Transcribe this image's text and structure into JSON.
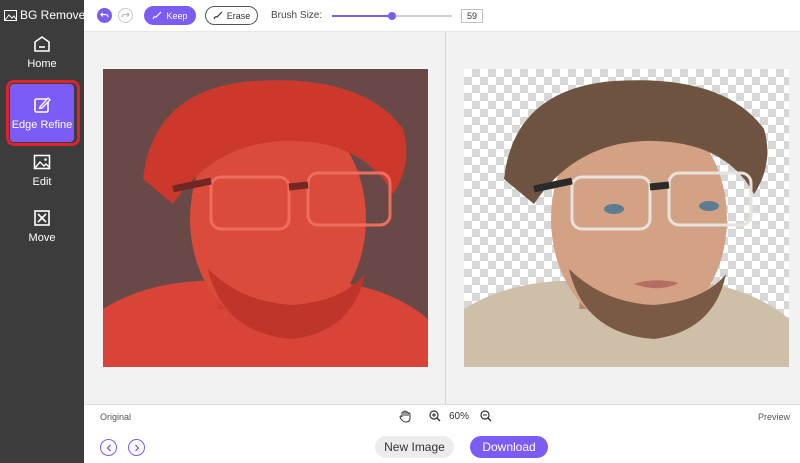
{
  "app": {
    "title": "BG Remover"
  },
  "sidebar": {
    "items": [
      {
        "label": "Home",
        "icon": "home-icon"
      },
      {
        "label": "Edge Refine",
        "icon": "edge-refine-icon",
        "active": true
      },
      {
        "label": "Edit",
        "icon": "image-edit-icon"
      },
      {
        "label": "Move",
        "icon": "move-icon"
      }
    ]
  },
  "toolbar": {
    "undo_icon": "undo-icon",
    "redo_icon": "redo-icon",
    "keep_label": "Keep",
    "erase_label": "Erase",
    "brush_label": "Brush Size:",
    "brush_value": "59",
    "brush_level_percent": 50
  },
  "status": {
    "original_label": "Original",
    "preview_label": "Preview",
    "zoom": "60%"
  },
  "bottom": {
    "new_image_label": "New Image",
    "download_label": "Download"
  },
  "colors": {
    "accent": "#7b5cf5",
    "sidebar_bg": "#3c3c3c",
    "highlight": "#e0232a",
    "mask_overlay": "#e53a2b"
  }
}
